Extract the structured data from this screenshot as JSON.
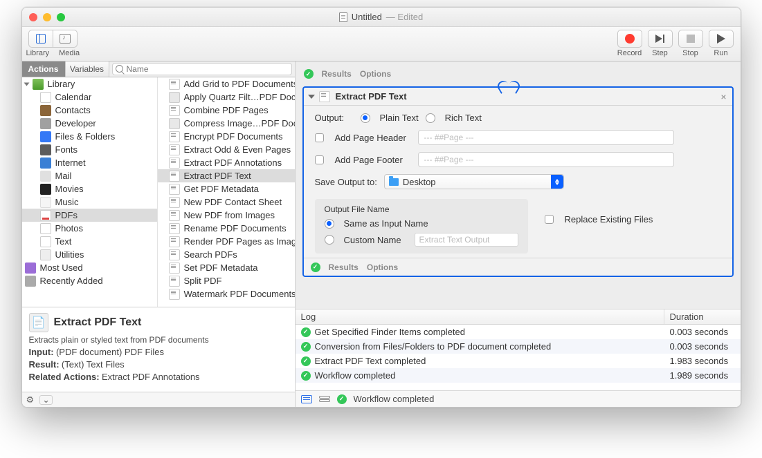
{
  "window": {
    "title": "Untitled",
    "subtitle": "— Edited"
  },
  "toolbar": {
    "library": "Library",
    "media": "Media",
    "record": "Record",
    "step": "Step",
    "stop": "Stop",
    "run": "Run"
  },
  "sidebar": {
    "tabs": {
      "actions": "Actions",
      "variables": "Variables"
    },
    "search_placeholder": "Name",
    "library_label": "Library",
    "categories": [
      "Calendar",
      "Contacts",
      "Developer",
      "Files & Folders",
      "Fonts",
      "Internet",
      "Mail",
      "Movies",
      "Music",
      "PDFs",
      "Photos",
      "Text",
      "Utilities"
    ],
    "extras": {
      "most_used": "Most Used",
      "recently_added": "Recently Added"
    }
  },
  "actions_list": [
    "Add Grid to PDF Documents",
    "Apply Quartz Filt…PDF Documents",
    "Combine PDF Pages",
    "Compress Image…PDF Documents",
    "Encrypt PDF Documents",
    "Extract Odd & Even Pages",
    "Extract PDF Annotations",
    "Extract PDF Text",
    "Get PDF Metadata",
    "New PDF Contact Sheet",
    "New PDF from Images",
    "Rename PDF Documents",
    "Render PDF Pages as Images",
    "Search PDFs",
    "Set PDF Metadata",
    "Split PDF",
    "Watermark PDF Documents"
  ],
  "selected_action_index": 7,
  "description": {
    "title": "Extract PDF Text",
    "summary": "Extracts plain or styled text from PDF documents",
    "input_label": "Input:",
    "input_value": "(PDF document) PDF Files",
    "result_label": "Result:",
    "result_value": "(Text) Text Files",
    "related_label": "Related Actions:",
    "related_value": "Extract PDF Annotations"
  },
  "action_card": {
    "results": "Results",
    "options": "Options",
    "title": "Extract PDF Text",
    "output_label": "Output:",
    "radio_plain": "Plain Text",
    "radio_rich": "Rich Text",
    "header_chk": "Add Page Header",
    "header_ph": "--- ##Page ---",
    "footer_chk": "Add Page Footer",
    "footer_ph": "--- ##Page ---",
    "save_label": "Save Output to:",
    "save_dest": "Desktop",
    "name_group": "Output File Name",
    "name_same": "Same as Input Name",
    "name_custom": "Custom Name",
    "name_custom_ph": "Extract Text Output",
    "replace_chk": "Replace Existing Files"
  },
  "log": {
    "header": "Log",
    "duration": "Duration",
    "rows": [
      {
        "msg": "Get Specified Finder Items completed",
        "dur": "0.003 seconds"
      },
      {
        "msg": "Conversion from Files/Folders to PDF document completed",
        "dur": "0.003 seconds"
      },
      {
        "msg": "Extract PDF Text completed",
        "dur": "1.983 seconds"
      },
      {
        "msg": "Workflow completed",
        "dur": "1.989 seconds"
      }
    ]
  },
  "bottom_status": "Workflow completed"
}
